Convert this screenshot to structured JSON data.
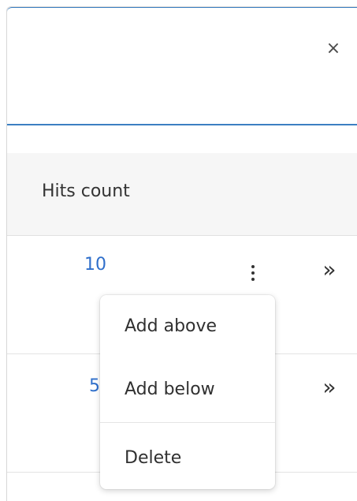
{
  "header": {
    "close_symbol": "×"
  },
  "table": {
    "column_header": "Hits count",
    "rows": [
      {
        "hits": "10",
        "expand_symbol": "»"
      },
      {
        "hits": "5",
        "expand_symbol": "»"
      }
    ]
  },
  "context_menu": {
    "items": [
      "Add above",
      "Add below",
      "Delete"
    ]
  },
  "colors": {
    "accent_border": "#3c7fc2",
    "link_blue": "#2f6fcb"
  },
  "icons": {
    "close": "close-icon",
    "more": "more-vertical-icon",
    "expand": "double-chevron-right-icon"
  }
}
